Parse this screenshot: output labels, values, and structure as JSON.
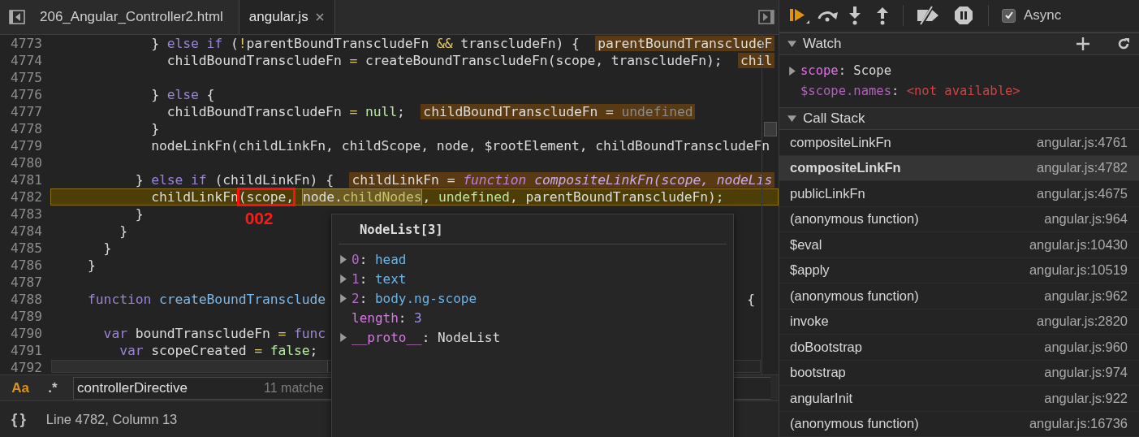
{
  "editor": {
    "tabs": [
      {
        "label": "206_Angular_Controller2.html",
        "selected": false,
        "closable": false
      },
      {
        "label": "angular.js",
        "selected": true,
        "closable": true
      }
    ],
    "lines": [
      {
        "number": "4773",
        "current": false,
        "tokens": [
          {
            "kind": "text",
            "text": "            } "
          },
          {
            "kind": "keyword",
            "text": "else if"
          },
          {
            "kind": "text",
            "text": " ("
          },
          {
            "kind": "op",
            "text": "!"
          },
          {
            "kind": "text",
            "text": "parentBoundTranscludeFn "
          },
          {
            "kind": "op",
            "text": "&&"
          },
          {
            "kind": "text",
            "text": " transcludeFn) {  "
          },
          {
            "kind": "inline_value",
            "parts": [
              {
                "kind": "text",
                "text": "parentBoundTranscludeF"
              }
            ]
          }
        ]
      },
      {
        "number": "4774",
        "current": false,
        "tokens": [
          {
            "kind": "text",
            "text": "              childBoundTranscludeFn "
          },
          {
            "kind": "op",
            "text": "="
          },
          {
            "kind": "text",
            "text": " createBoundTranscludeFn(scope, transcludeFn);  "
          },
          {
            "kind": "inline_value",
            "parts": [
              {
                "kind": "text",
                "text": "chil"
              }
            ]
          }
        ]
      },
      {
        "number": "4775",
        "current": false
      },
      {
        "number": "4776",
        "current": false,
        "tokens": [
          {
            "kind": "text",
            "text": "            } "
          },
          {
            "kind": "keyword",
            "text": "else"
          },
          {
            "kind": "text",
            "text": " {"
          }
        ]
      },
      {
        "number": "4777",
        "current": false,
        "tokens": [
          {
            "kind": "text",
            "text": "              childBoundTranscludeFn "
          },
          {
            "kind": "op",
            "text": "= "
          },
          {
            "kind": "literal",
            "text": "null"
          },
          {
            "kind": "text",
            "text": ";  "
          },
          {
            "kind": "inline_value",
            "parts": [
              {
                "kind": "text",
                "text": "childBoundTranscludeFn = "
              },
              {
                "kind": "dim",
                "text": "undefined"
              }
            ]
          }
        ]
      },
      {
        "number": "4778",
        "current": false,
        "tokens": [
          {
            "kind": "text",
            "text": "            }"
          }
        ]
      },
      {
        "number": "4779",
        "current": false,
        "tokens": [
          {
            "kind": "text",
            "text": "            nodeLinkFn(childLinkFn, childScope, node, $rootElement, childBoundTranscludeFn"
          }
        ]
      },
      {
        "number": "4780",
        "current": false
      },
      {
        "number": "4781",
        "current": false,
        "tokens": [
          {
            "kind": "text",
            "text": "          } "
          },
          {
            "kind": "keyword",
            "text": "else if"
          },
          {
            "kind": "text",
            "text": " (childLinkFn) {  "
          },
          {
            "kind": "inline_value",
            "parts": [
              {
                "kind": "text",
                "text": "childLinkFn = "
              },
              {
                "kind": "italic_keyword",
                "text": "function"
              },
              {
                "kind": "italic_text",
                "text": " compositeLinkFn(scope, nodeLis"
              }
            ]
          }
        ]
      },
      {
        "number": "4782",
        "current": true,
        "tokens": [
          {
            "kind": "text",
            "text": "            childLinkFn"
          },
          {
            "kind": "boxed",
            "label": "002",
            "parts": [
              {
                "kind": "text",
                "text": "(scope,"
              }
            ]
          },
          {
            "kind": "hovered",
            "parts": [
              {
                "kind": "text",
                "text": "node."
              },
              {
                "kind": "prop",
                "text": "childNodes"
              }
            ]
          },
          {
            "kind": "text",
            "text": ", "
          },
          {
            "kind": "literal",
            "text": "undefined"
          },
          {
            "kind": "text",
            "text": ", parentBoundTranscludeFn);"
          }
        ]
      },
      {
        "number": "4783",
        "current": false,
        "tokens": [
          {
            "kind": "text",
            "text": "          }"
          }
        ]
      },
      {
        "number": "4784",
        "current": false,
        "tokens": [
          {
            "kind": "text",
            "text": "        }"
          }
        ]
      },
      {
        "number": "4785",
        "current": false,
        "tokens": [
          {
            "kind": "text",
            "text": "      }"
          }
        ]
      },
      {
        "number": "4786",
        "current": false,
        "tokens": [
          {
            "kind": "text",
            "text": "    }"
          }
        ]
      },
      {
        "number": "4787",
        "current": false
      },
      {
        "number": "4788",
        "current": false,
        "tokens": [
          {
            "kind": "keyword",
            "text": "    function "
          },
          {
            "kind": "fn",
            "text": "createBoundTransclude"
          },
          {
            "kind": "far",
            "text": "{"
          }
        ]
      },
      {
        "number": "4789",
        "current": false
      },
      {
        "number": "4790",
        "current": false,
        "tokens": [
          {
            "kind": "keyword",
            "text": "      var"
          },
          {
            "kind": "text",
            "text": " boundTranscludeFn "
          },
          {
            "kind": "op",
            "text": "= "
          },
          {
            "kind": "keyword",
            "text": "func"
          }
        ]
      },
      {
        "number": "4791",
        "current": false,
        "tokens": [
          {
            "kind": "keyword",
            "text": "        var"
          },
          {
            "kind": "text",
            "text": " scopeCreated "
          },
          {
            "kind": "op",
            "text": "= "
          },
          {
            "kind": "literal",
            "text": "false"
          },
          {
            "kind": "text",
            "text": ";"
          }
        ]
      },
      {
        "number": "4792",
        "current": false
      }
    ],
    "search": {
      "case_toggle": "Aa",
      "regex_toggle": ".*",
      "value": "controllerDirective",
      "matches": "11 matche"
    },
    "status": {
      "format_button": "{}",
      "position": "Line 4782, Column 13"
    },
    "popover": {
      "title": "NodeList[3]",
      "entries": [
        {
          "kind": "index",
          "key": "0",
          "separator": ": ",
          "value": "head",
          "expandable": true
        },
        {
          "kind": "index",
          "key": "1",
          "separator": ": ",
          "value": "text",
          "expandable": true
        },
        {
          "kind": "index",
          "key": "2",
          "separator": ": ",
          "value": "body.ng-scope",
          "expandable": true
        },
        {
          "kind": "number",
          "key": "length",
          "separator": ": ",
          "value": "3",
          "expandable": false
        },
        {
          "kind": "object",
          "key": "__proto__",
          "separator": ": ",
          "value": "NodeList",
          "expandable": true
        }
      ]
    }
  },
  "debugger": {
    "async": {
      "label": "Async",
      "checked": true
    },
    "watch": {
      "title": "Watch",
      "expanded": true,
      "items": [
        {
          "kind": "object",
          "name": "scope",
          "separator": ": ",
          "value": "Scope",
          "expandable": true
        },
        {
          "kind": "error",
          "name": "$scope.names",
          "separator": ": ",
          "value": "<not available>",
          "expandable": false
        }
      ]
    },
    "call_stack": {
      "title": "Call Stack",
      "expanded": true,
      "frames": [
        {
          "name": "compositeLinkFn",
          "location": "angular.js:4761",
          "selected": false
        },
        {
          "name": "compositeLinkFn",
          "location": "angular.js:4782",
          "selected": true
        },
        {
          "name": "publicLinkFn",
          "location": "angular.js:4675",
          "selected": false
        },
        {
          "name": "(anonymous function)",
          "location": "angular.js:964",
          "selected": false
        },
        {
          "name": "$eval",
          "location": "angular.js:10430",
          "selected": false
        },
        {
          "name": "$apply",
          "location": "angular.js:10519",
          "selected": false
        },
        {
          "name": "(anonymous function)",
          "location": "angular.js:962",
          "selected": false
        },
        {
          "name": "invoke",
          "location": "angular.js:2820",
          "selected": false
        },
        {
          "name": "doBootstrap",
          "location": "angular.js:960",
          "selected": false
        },
        {
          "name": "bootstrap",
          "location": "angular.js:974",
          "selected": false
        },
        {
          "name": "angularInit",
          "location": "angular.js:922",
          "selected": false
        },
        {
          "name": "(anonymous function)",
          "location": "angular.js:16736",
          "selected": false
        }
      ]
    }
  }
}
